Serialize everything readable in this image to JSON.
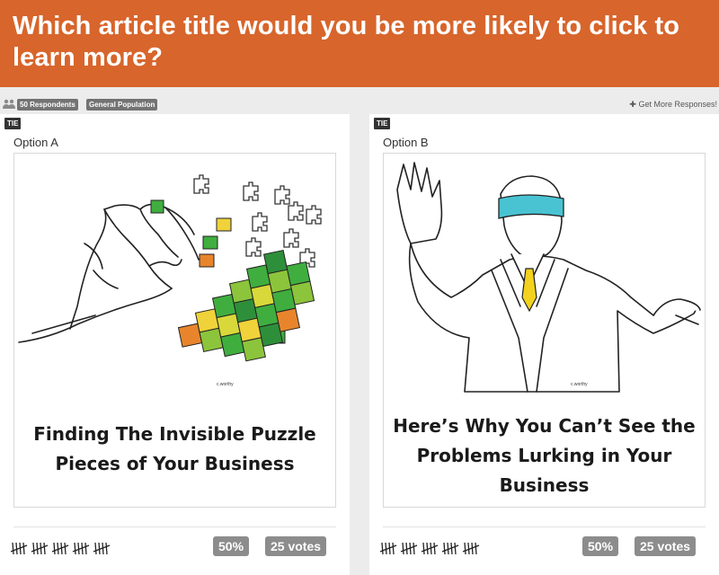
{
  "question": "Which article title would you be more likely to click to learn more?",
  "meta": {
    "respondents": "50 Respondents",
    "population": "General Population",
    "more_link": "Get More Responses!"
  },
  "options": [
    {
      "badge": "TIE",
      "label": "Option A",
      "title_lines": [
        "Finding The Invisible Puzzle",
        "Pieces of Your Business"
      ],
      "tally_count": 25,
      "percent": "50%",
      "votes": "25 votes"
    },
    {
      "badge": "TIE",
      "label": "Option B",
      "title_lines": [
        "Here’s Why You Can’t See the",
        "Problems Lurking in Your",
        "Business"
      ],
      "tally_count": 25,
      "percent": "50%",
      "votes": "25 votes"
    }
  ],
  "colors": {
    "header_bg": "#d8652b",
    "badge_gray": "#8c8c8c",
    "blindfold": "#49c3d2",
    "tie_yellow": "#f2d21e"
  },
  "icons": {
    "people": "people-icon",
    "plus": "plus-icon"
  }
}
